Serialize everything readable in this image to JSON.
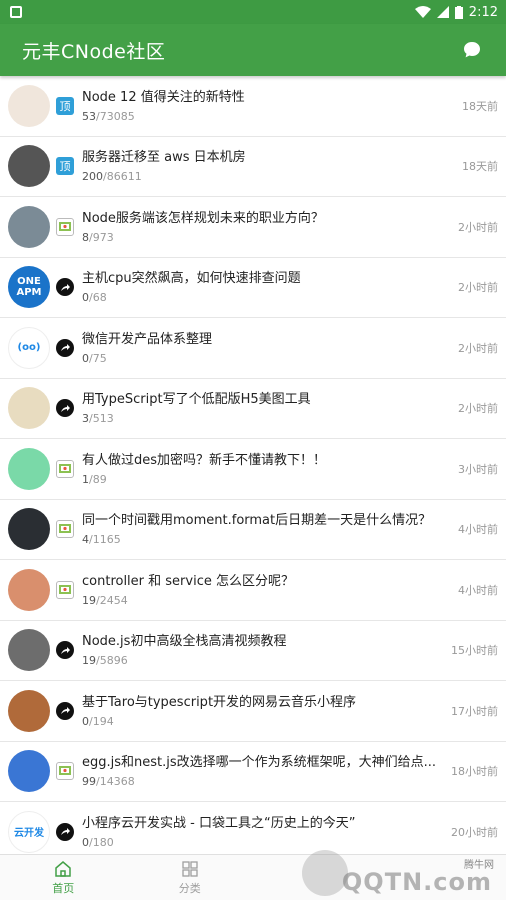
{
  "status": {
    "time": "2:12"
  },
  "app": {
    "title": "元丰CNode社区"
  },
  "topics": [
    {
      "avatar": "mascot",
      "avatar_color": "#f0e6dc",
      "tag": "top",
      "tag_text": "顶",
      "title": "Node 12 值得关注的新特性",
      "replies": "53",
      "views": "73085",
      "time": "18天前"
    },
    {
      "avatar": "person",
      "avatar_color": "#555555",
      "tag": "top",
      "tag_text": "顶",
      "title": "服务器迁移至 aws 日本机房",
      "replies": "200",
      "views": "86611",
      "time": "18天前"
    },
    {
      "avatar": "photo",
      "avatar_color": "#7b8b96",
      "tag": "ask",
      "tag_text": "",
      "title": "Node服务端该怎样规划未来的职业方向？",
      "replies": "8",
      "views": "973",
      "time": "2小时前"
    },
    {
      "avatar": "oneapm",
      "avatar_color": "#1a73c9",
      "avatar_text": "ONE APM",
      "tag": "share",
      "tag_text": "",
      "title": "主机cpu突然飙高，如何快速排查问题",
      "replies": "0",
      "views": "68",
      "time": "2小时前"
    },
    {
      "avatar": "face",
      "avatar_color": "#ffffff",
      "avatar_text": "(oo)",
      "tag": "share",
      "tag_text": "",
      "title": "微信开发产品体系整理",
      "replies": "0",
      "views": "75",
      "time": "2小时前"
    },
    {
      "avatar": "rabbit",
      "avatar_color": "#e8dcc0",
      "tag": "share",
      "tag_text": "",
      "title": "用TypeScript写了个低配版H5美图工具",
      "replies": "3",
      "views": "513",
      "time": "2小时前"
    },
    {
      "avatar": "pixel",
      "avatar_color": "#7ad9a8",
      "tag": "ask",
      "tag_text": "",
      "title": "有人做过des加密吗？新手不懂请教下！！",
      "replies": "1",
      "views": "89",
      "time": "3小时前"
    },
    {
      "avatar": "dark",
      "avatar_color": "#2a2e33",
      "tag": "ask",
      "tag_text": "",
      "title": "同一个时间戳用moment.format后日期差一天是什么情况？",
      "replies": "4",
      "views": "1165",
      "time": "4小时前"
    },
    {
      "avatar": "pixel2",
      "avatar_color": "#d98f6d",
      "tag": "ask",
      "tag_text": "",
      "title": "controller 和 service 怎么区分呢？",
      "replies": "19",
      "views": "2454",
      "time": "4小时前"
    },
    {
      "avatar": "person2",
      "avatar_color": "#6d6d6d",
      "tag": "share",
      "tag_text": "",
      "title": "Node.js初中高级全栈高清视频教程",
      "replies": "19",
      "views": "5896",
      "time": "15小时前"
    },
    {
      "avatar": "person3",
      "avatar_color": "#b06a3a",
      "tag": "share",
      "tag_text": "",
      "title": "基于Taro与typescript开发的网易云音乐小程序",
      "replies": "0",
      "views": "194",
      "time": "17小时前"
    },
    {
      "avatar": "cookie",
      "avatar_color": "#3a76d4",
      "tag": "ask",
      "tag_text": "",
      "title": "egg.js和nest.js改选择哪一个作为系统框架呢，大神们给点...",
      "replies": "99",
      "views": "14368",
      "time": "18小时前"
    },
    {
      "avatar": "cloud",
      "avatar_color": "#ffffff",
      "avatar_text": "云开发",
      "tag": "share",
      "tag_text": "",
      "title": "小程序云开发实战 - 口袋工具之“历史上的今天”",
      "replies": "0",
      "views": "180",
      "time": "20小时前"
    }
  ],
  "tabs": [
    {
      "label": "首页",
      "active": true
    },
    {
      "label": "分类",
      "active": false
    }
  ],
  "watermark": {
    "small": "腾牛网",
    "big": "QQTN.com"
  }
}
